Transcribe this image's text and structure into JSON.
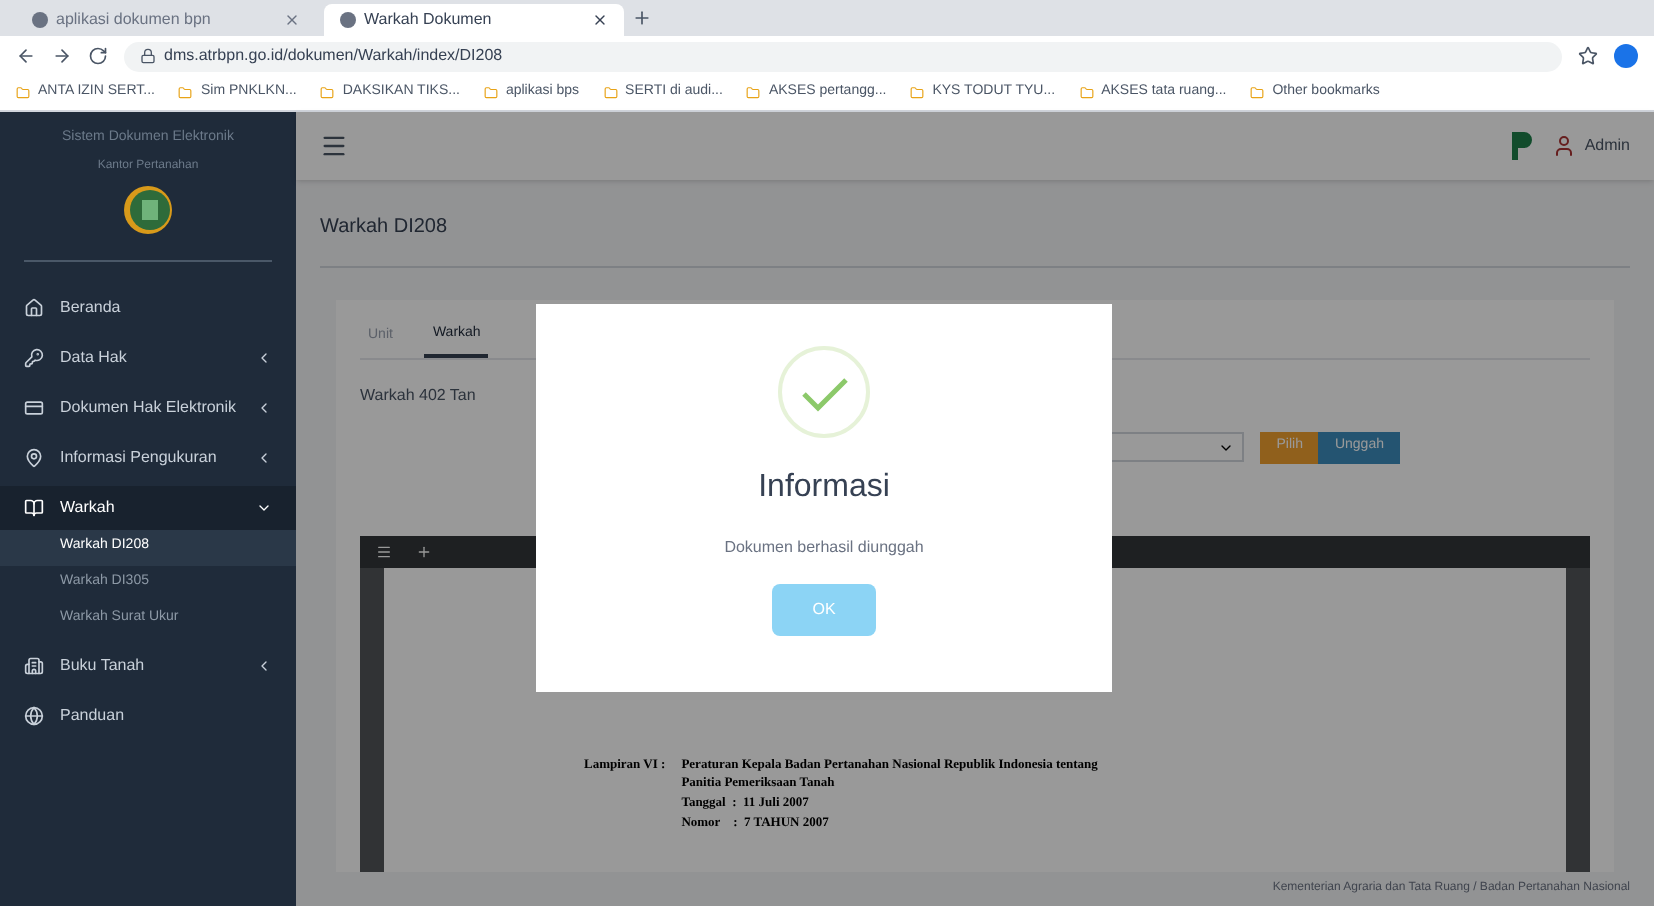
{
  "browser": {
    "tabs": [
      {
        "title": "aplikasi dokumen bpn",
        "selected": false
      },
      {
        "title": "Warkah Dokumen",
        "selected": true
      }
    ],
    "url": "dms.atrbpn.go.id/dokumen/Warkah/index/DI208",
    "bookmarks": [
      "ANTA IZIN SERT...",
      "Sim PNKLKN...",
      "DAKSIKAN TIKS...",
      "aplikasi bps",
      "SERTI di audi...",
      "AKSES pertangg...",
      "KYS TODUT TYU...",
      "AKSES tata ruang...",
      "Other bookmarks"
    ]
  },
  "sidebar": {
    "app_title": "Sistem Dokumen Elektronik",
    "app_subtitle": "Kantor Pertanahan",
    "items": [
      {
        "label": "Beranda",
        "expandable": false,
        "expanded": false
      },
      {
        "label": "Data Hak",
        "expandable": true,
        "expanded": false
      },
      {
        "label": "Dokumen Hak Elektronik",
        "expandable": true,
        "expanded": false
      },
      {
        "label": "Informasi Pengukuran",
        "expandable": true,
        "expanded": false
      },
      {
        "label": "Warkah",
        "expandable": true,
        "expanded": true,
        "children": [
          {
            "label": "Warkah DI208",
            "selected": true
          },
          {
            "label": "Warkah DI305",
            "selected": false
          },
          {
            "label": "Warkah Surat Ukur",
            "selected": false
          }
        ]
      },
      {
        "label": "Buku Tanah",
        "expandable": true,
        "expanded": false
      },
      {
        "label": "Panduan",
        "expandable": false,
        "expanded": false
      }
    ]
  },
  "header": {
    "user": "Admin"
  },
  "page": {
    "title": "Warkah DI208",
    "tabs": [
      {
        "label": "Unit",
        "selected": false
      },
      {
        "label": "Warkah",
        "selected": true
      }
    ],
    "field_label": "Warkah 402 Tan",
    "buttons": [
      {
        "label": "Pilih",
        "kind": "warning"
      },
      {
        "label": "Unggah",
        "kind": "primary"
      }
    ],
    "document": {
      "lines": [
        "Lampiran VI :",
        "Peraturan Kepala Badan Pertanahan Nasional Republik Indonesia tentang",
        "Panitia Pemeriksaan Tanah",
        "Tanggal  :  11 Juli 2007",
        "Nomor    :  7 TAHUN 2007"
      ]
    },
    "footer": "Kementerian Agraria dan Tata Ruang / Badan Pertanahan Nasional"
  },
  "dialog": {
    "title": "Informasi",
    "message": "Dokumen berhasil diunggah",
    "button": "OK"
  }
}
